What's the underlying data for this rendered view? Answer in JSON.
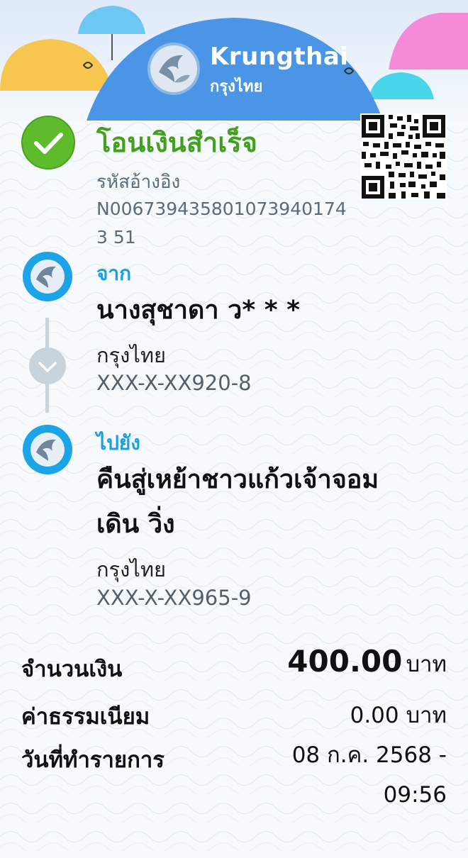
{
  "header": {
    "brand_en": "Krungthai",
    "brand_th": "กรุงไทย"
  },
  "status": {
    "title": "โอนเงินสำเร็จ",
    "icon": "check-icon",
    "color": "#43a01e"
  },
  "reference": {
    "label": "รหัสอ้างอิง",
    "value": "N0067394358010739401743 51"
  },
  "from": {
    "label": "จาก",
    "name": "นางสุชาดา ว* * *",
    "bank": "กรุงไทย",
    "account": "XXX-X-XX920-8"
  },
  "to": {
    "label": "ไปยัง",
    "name_line1": "คืนสู่เหย้าชาวแก้วเจ้าจอม",
    "name_line2": "เดิน วิ่ง",
    "bank": "กรุงไทย",
    "account": "XXX-X-XX965-9"
  },
  "summary": {
    "amount_label": "จำนวนเงิน",
    "amount": "400.00",
    "amount_unit": "บาท",
    "fee_label": "ค่าธรรมเนียม",
    "fee": "0.00 บาท",
    "date_label": "วันที่ทำรายการ",
    "date": "08 ก.ค. 2568 -",
    "time": "09:56"
  },
  "colors": {
    "accent_blue": "#1aa0e0",
    "success_green": "#43a01e",
    "header_blue": "#4a95e6"
  }
}
